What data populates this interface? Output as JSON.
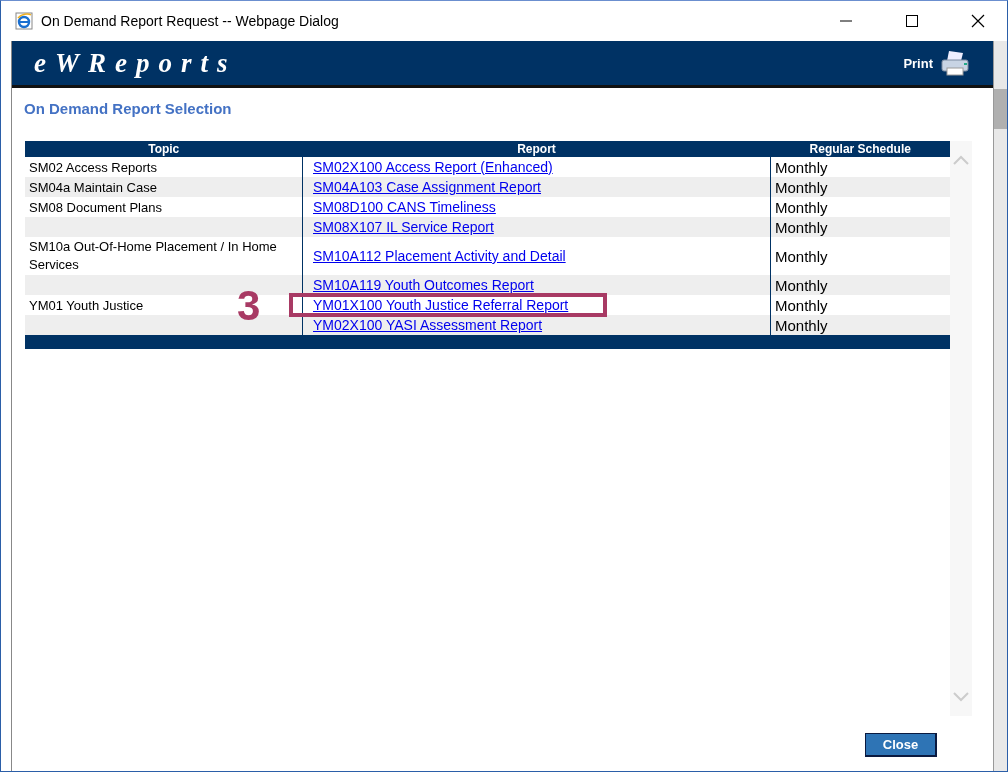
{
  "window": {
    "title": "On Demand Report Request -- Webpage Dialog"
  },
  "header": {
    "logo": "eWReports",
    "print": "Print"
  },
  "heading": "On Demand Report Selection",
  "table": {
    "columns": [
      "Topic",
      "Report",
      "Regular Schedule"
    ],
    "rows": [
      {
        "topic": "SM02 Access Reports",
        "report": "SM02X100 Access Report (Enhanced)",
        "schedule": "Monthly",
        "highlighted": false
      },
      {
        "topic": "SM04a Maintain Case",
        "report": "SM04A103 Case Assignment Report",
        "schedule": "Monthly",
        "highlighted": false
      },
      {
        "topic": "SM08 Document Plans",
        "report": "SM08D100 CANS Timeliness",
        "schedule": "Monthly",
        "highlighted": false
      },
      {
        "topic": "",
        "report": "SM08X107 IL Service Report",
        "schedule": "Monthly",
        "highlighted": false
      },
      {
        "topic": "SM10a Out-Of-Home Placement / In Home Services",
        "report": "SM10A112 Placement Activity and Detail",
        "schedule": "Monthly",
        "highlighted": false
      },
      {
        "topic": "",
        "report": "SM10A119 Youth Outcomes Report",
        "schedule": "Monthly",
        "highlighted": false
      },
      {
        "topic": "YM01 Youth Justice",
        "report": "YM01X100 Youth Justice Referral Report",
        "schedule": "Monthly",
        "highlighted": true
      },
      {
        "topic": "",
        "report": "YM02X100 YASI Assessment Report",
        "schedule": "Monthly",
        "highlighted": false
      }
    ]
  },
  "annotation": {
    "number": "3"
  },
  "close_button": "Close"
}
